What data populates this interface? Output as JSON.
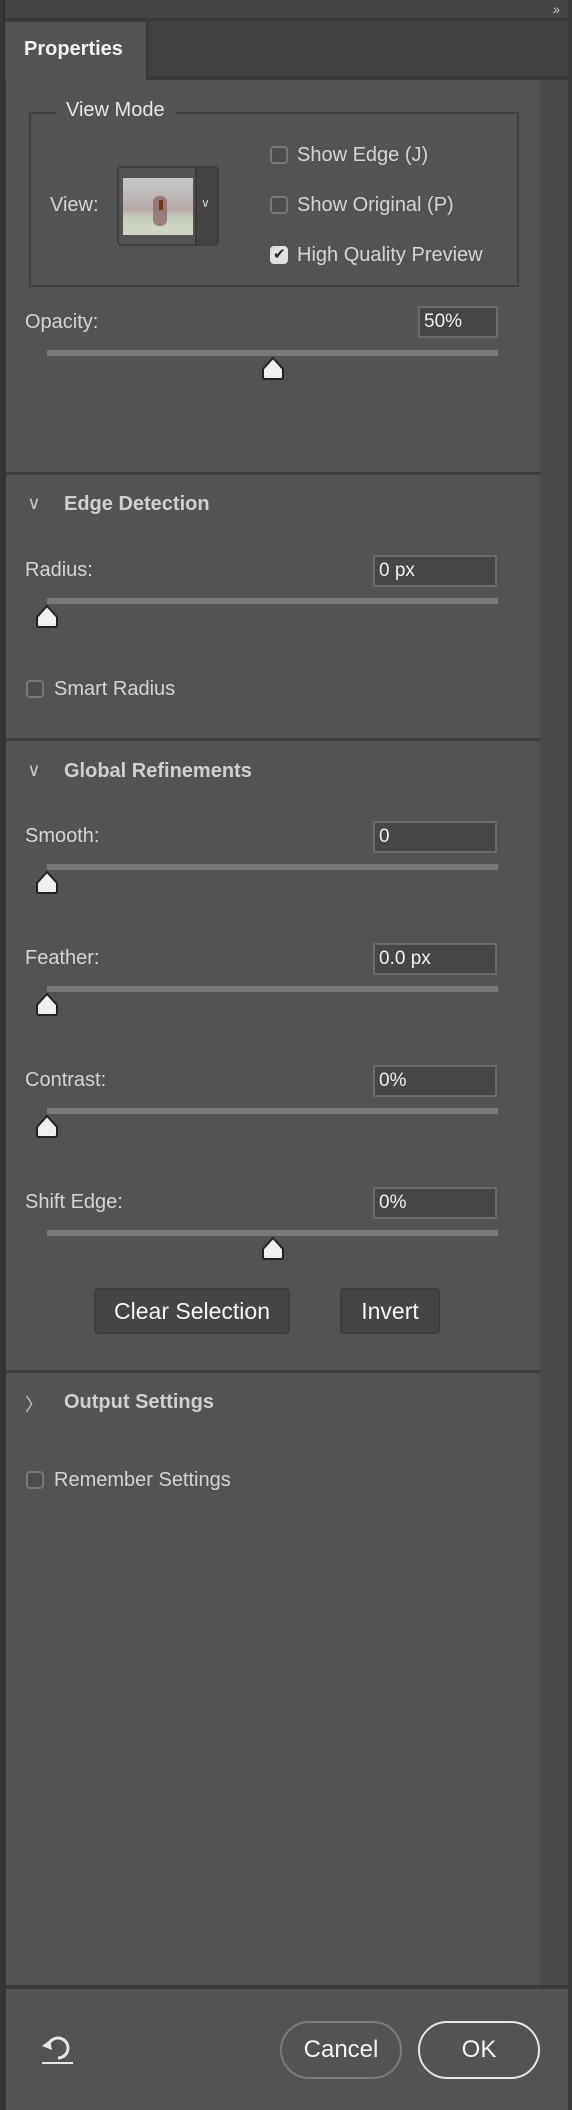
{
  "panel": {
    "tab_label": "Properties",
    "collapse_icon": "double-chevron-right-icon"
  },
  "view_mode": {
    "title": "View Mode",
    "view_label": "View:",
    "view_thumbnail": "photo-preview-soccer-player",
    "checkboxes": [
      {
        "label": "Show Edge (J)",
        "checked": false
      },
      {
        "label": "Show Original (P)",
        "checked": false
      },
      {
        "label": "High Quality Preview",
        "checked": true
      }
    ],
    "opacity": {
      "label": "Opacity:",
      "value": "50%",
      "slider_fraction": 0.5
    }
  },
  "edge_detection": {
    "title": "Edge Detection",
    "expanded": true,
    "radius": {
      "label": "Radius:",
      "value": "0 px",
      "slider_fraction": 0.0
    },
    "smart_radius": {
      "label": "Smart Radius",
      "checked": false
    }
  },
  "global_refinements": {
    "title": "Global Refinements",
    "expanded": true,
    "sliders": [
      {
        "label": "Smooth:",
        "value": "0",
        "slider_fraction": 0.0
      },
      {
        "label": "Feather:",
        "value": "0.0 px",
        "slider_fraction": 0.0
      },
      {
        "label": "Contrast:",
        "value": "0%",
        "slider_fraction": 0.0
      },
      {
        "label": "Shift Edge:",
        "value": "0%",
        "slider_fraction": 0.5
      }
    ],
    "clear_selection_label": "Clear Selection",
    "invert_label": "Invert"
  },
  "output_settings": {
    "title": "Output Settings",
    "expanded": false
  },
  "remember_settings": {
    "label": "Remember Settings",
    "checked": false
  },
  "footer": {
    "reset_icon": "reset-undo-icon",
    "cancel_label": "Cancel",
    "ok_label": "OK"
  }
}
